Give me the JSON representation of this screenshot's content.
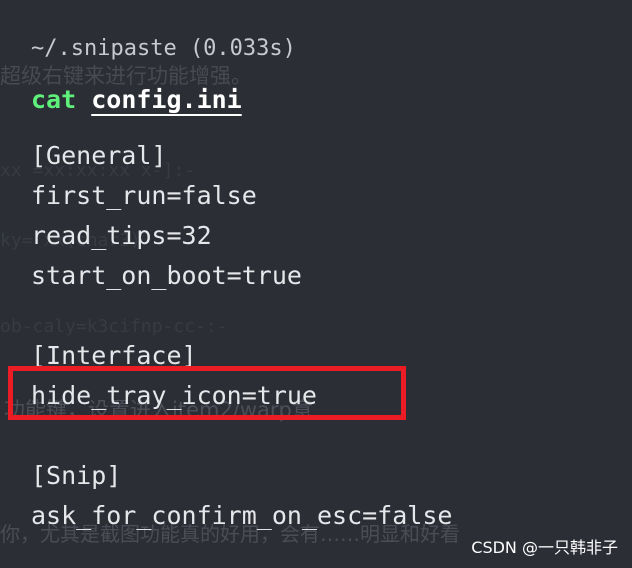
{
  "terminal": {
    "path_line": "~/.snipaste (0.033s)",
    "command": {
      "name": "cat",
      "argument": "config.ini"
    },
    "output": [
      "[General]",
      "first_run=false",
      "read_tips=32",
      "start_on_boot=true",
      "[Interface]",
      "hide_tray_icon=true",
      "[Snip]",
      "ask_for_confirm_on_esc=false"
    ]
  },
  "colors": {
    "background": "#2c2e36",
    "command_green": "#5ef07a",
    "highlight_red": "#ec1c24"
  },
  "watermark": {
    "text": "CSDN @一只韩非子"
  }
}
